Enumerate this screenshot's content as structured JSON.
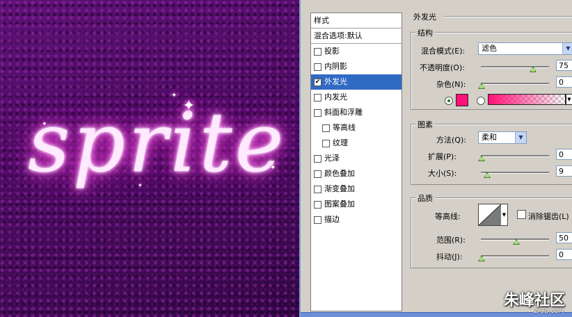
{
  "artwork": {
    "word": "sprite"
  },
  "styles_list": {
    "header": "样式",
    "blend_options": "混合选项:默认",
    "items": [
      {
        "label": "投影",
        "checked": false,
        "indent": false,
        "selected": false
      },
      {
        "label": "内阴影",
        "checked": false,
        "indent": false,
        "selected": false
      },
      {
        "label": "外发光",
        "checked": true,
        "indent": false,
        "selected": true
      },
      {
        "label": "内发光",
        "checked": false,
        "indent": false,
        "selected": false
      },
      {
        "label": "斜面和浮雕",
        "checked": false,
        "indent": false,
        "selected": false
      },
      {
        "label": "等高线",
        "checked": false,
        "indent": true,
        "selected": false
      },
      {
        "label": "纹理",
        "checked": false,
        "indent": true,
        "selected": false
      },
      {
        "label": "光泽",
        "checked": false,
        "indent": false,
        "selected": false
      },
      {
        "label": "颜色叠加",
        "checked": false,
        "indent": false,
        "selected": false
      },
      {
        "label": "渐变叠加",
        "checked": false,
        "indent": false,
        "selected": false
      },
      {
        "label": "图案叠加",
        "checked": false,
        "indent": false,
        "selected": false
      },
      {
        "label": "描边",
        "checked": false,
        "indent": false,
        "selected": false
      }
    ]
  },
  "outer_glow": {
    "title": "外发光",
    "structure": {
      "label": "结构",
      "blend_mode_label": "混合模式(E):",
      "blend_mode_value": "滤色",
      "opacity_label": "不透明度(O):",
      "opacity_value": "75",
      "noise_label": "杂色(N):",
      "noise_value": "0",
      "percent": "%",
      "glow_color": "#ff1177"
    },
    "elements": {
      "label": "图素",
      "technique_label": "方法(Q):",
      "technique_value": "柔和",
      "spread_label": "扩展(P):",
      "spread_value": "0",
      "size_label": "大小(S):",
      "size_value": "9",
      "percent": "%",
      "px_unit": "像素"
    },
    "quality": {
      "label": "品质",
      "contour_label": "等高线:",
      "anti_alias_label": "消除锯齿(L)",
      "range_label": "范围(R):",
      "range_value": "50",
      "jitter_label": "抖动(J):",
      "jitter_value": "0",
      "percent": "%"
    }
  },
  "watermark": {
    "brand": "朱峰社区",
    "url": "ZF3D.COM"
  }
}
